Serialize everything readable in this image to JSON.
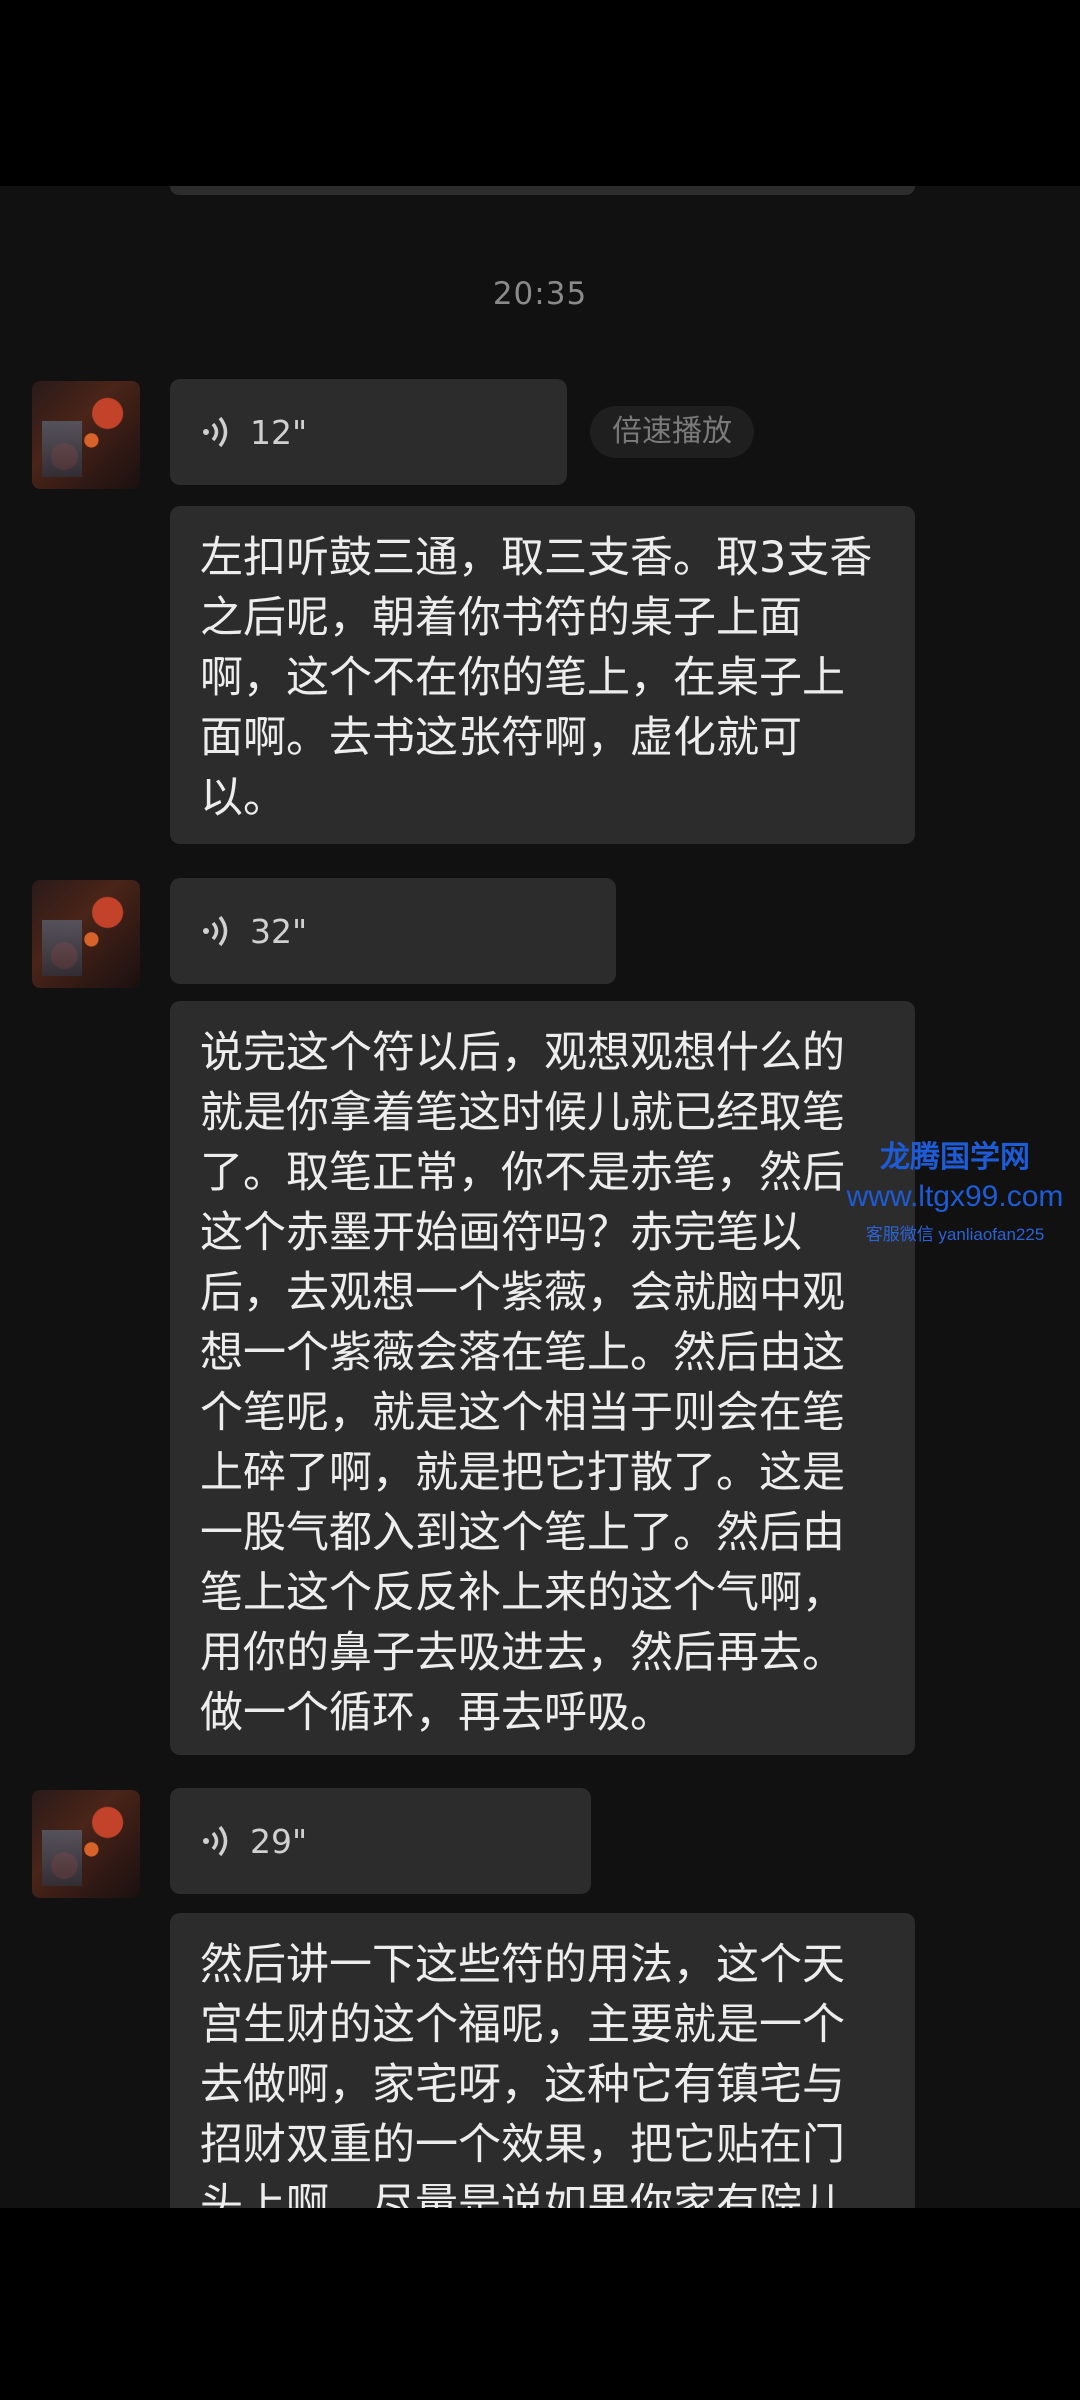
{
  "chat": {
    "timestamp": "20:35",
    "messages": [
      {
        "duration": "12\"",
        "speed_label": "倍速播放",
        "transcript": "左扣听鼓三通，取三支香。取3支香之后呢，朝着你书符的桌子上面啊，这个不在你的笔上，在桌子上面啊。去书这张符啊，虚化就可以。"
      },
      {
        "duration": "32\"",
        "transcript": "说完这个符以后，观想观想什么的就是你拿着笔这时候儿就已经取笔了。取笔正常，你不是赤笔，然后这个赤墨开始画符吗？赤完笔以后，去观想一个紫薇，会就脑中观想一个紫薇会落在笔上。然后由这个笔呢，就是这个相当于则会在笔上碎了啊，就是把它打散了。这是一股气都入到这个笔上了。然后由笔上这个反反补上来的这个气啊，用你的鼻子去吸进去，然后再去。做一个循环，再去呼吸。"
      },
      {
        "duration": "29\"",
        "transcript": "然后讲一下这些符的用法，这个天宫生财的这个福呢，主要就是一个去做啊，家宅呀，这种它有镇宅与招财双重的一个效果，把它贴在门头上啊，尽量是说如果你家有院儿"
      }
    ]
  },
  "watermark": {
    "title": "龙腾国学网",
    "url": "www.ltgx99.com",
    "note": "客服微信 yanliaofan225"
  },
  "icons": {
    "voice": "sound-wave-icon"
  },
  "colors": {
    "bubble": "#2c2c2c",
    "text": "#ededed",
    "watermark": "#1e5bd6"
  }
}
